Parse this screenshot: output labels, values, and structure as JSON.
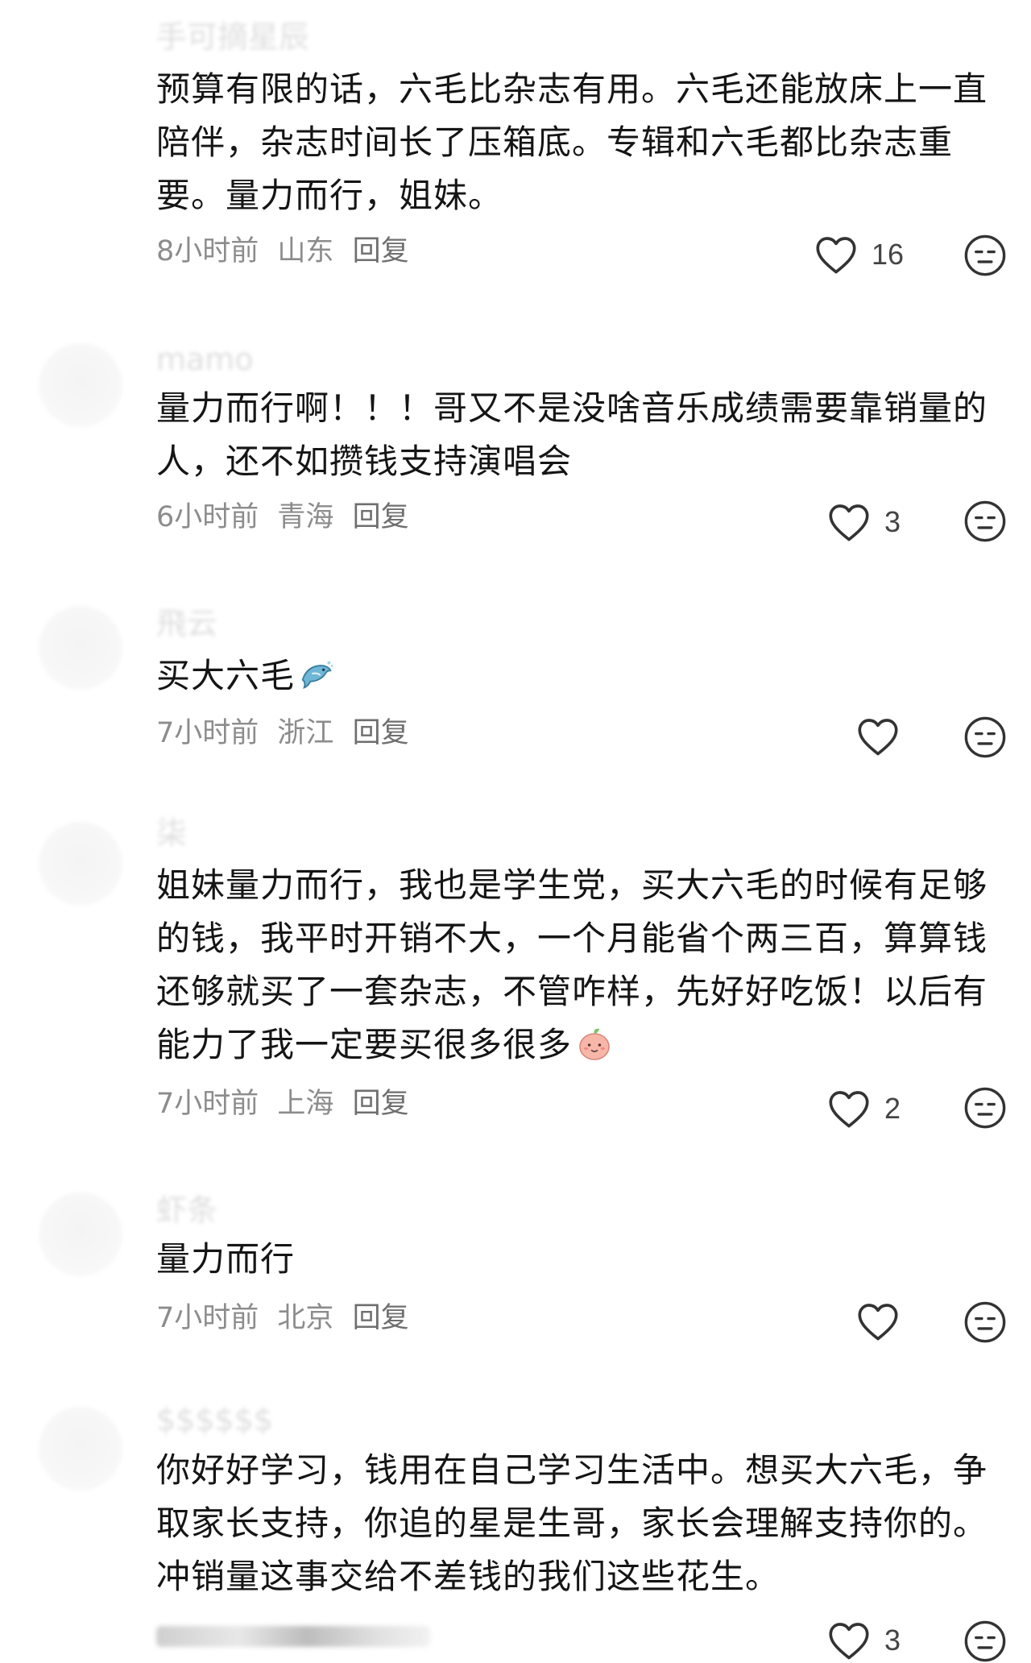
{
  "comments": [
    {
      "username": "手可摘星辰",
      "text": "预算有限的话，六毛比杂志有用。六毛还能放床上一直陪伴，杂志时间长了压箱底。专辑和六毛都比杂志重要。量力而行，姐妹。",
      "time": "8小时前",
      "location": "山东",
      "reply": "回复",
      "likes": "16"
    },
    {
      "username": "mamo",
      "text": "量力而行啊！！！哥又不是没啥音乐成绩需要靠销量的人，还不如攒钱支持演唱会",
      "time": "6小时前",
      "location": "青海",
      "reply": "回复",
      "likes": "3"
    },
    {
      "username": "飛云",
      "text": "买大六毛",
      "emoji": "dolphin-emoji",
      "time": "7小时前",
      "location": "浙江",
      "reply": "回复",
      "likes": ""
    },
    {
      "username": "柒",
      "text": "姐妹量力而行，我也是学生党，买大六毛的时候有足够的钱，我平时开销不大，一个月能省个两三百，算算钱还够就买了一套杂志，不管咋样，先好好吃饭！以后有能力了我一定要买很多很多",
      "emoji": "peach-emoji",
      "time": "7小时前",
      "location": "上海",
      "reply": "回复",
      "likes": "2"
    },
    {
      "username": "虾条",
      "text": "量力而行",
      "time": "7小时前",
      "location": "北京",
      "reply": "回复",
      "likes": ""
    },
    {
      "username": "$$$$$$",
      "text": "你好好学习，钱用在自己学习生活中。想买大六毛，争取家长支持，你追的星是生哥，家长会理解支持你的。冲销量这事交给不差钱的我们这些花生。",
      "time": "",
      "location": "",
      "reply": "",
      "likes": "3"
    }
  ],
  "colors": {
    "text": "#151515",
    "meta": "#8c8c8c",
    "icon": "#333333",
    "background": "#ffffff"
  }
}
